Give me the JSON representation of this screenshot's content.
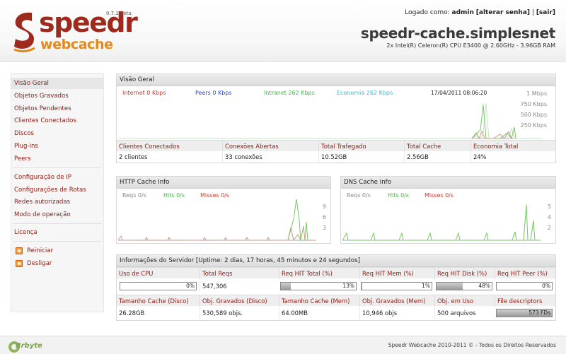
{
  "header": {
    "logo_top": "speedr",
    "logo_bottom": "webcache",
    "version": "0.7.1 beta",
    "login_prefix": "Logado como:",
    "user": "admin",
    "change_password": "[alterar senha]",
    "separator": "|",
    "logout": "[sair]",
    "hostname": "speedr-cache.simplesnet",
    "cpu": "2x Intel(R) Celeron(R) CPU E3400 @ 2.60GHz - 3.96GB RAM"
  },
  "sidebar": {
    "items": [
      {
        "label": "Visão Geral",
        "active": true
      },
      {
        "label": "Objetos Gravados"
      },
      {
        "label": "Objetos Pendentes"
      },
      {
        "label": "Clientes Conectados"
      },
      {
        "label": "Discos"
      },
      {
        "label": "Plug-ins"
      },
      {
        "label": "Peers"
      }
    ],
    "config_items": [
      {
        "label": "Configuração de IP"
      },
      {
        "label": "Configurações de Rotas"
      },
      {
        "label": "Redes autorizadas"
      },
      {
        "label": "Modo de operação"
      }
    ],
    "license": "Licença",
    "actions": [
      {
        "label": "Reiniciar",
        "icon": "restart-icon"
      },
      {
        "label": "Desligar",
        "icon": "power-icon"
      }
    ]
  },
  "overview": {
    "title": "Visão Geral",
    "internet": "Internet 0 Kbps",
    "peers": "Peers 0 Kbps",
    "intranet": "Intranet 262 Kbps",
    "economia": "Economia 262 Kbps",
    "timestamp": "17/04/2011 08:06:20",
    "axis": [
      "1 Mbps",
      "750 Kbps",
      "500 Kbps",
      "250 Kbps"
    ],
    "headers": [
      "Clientes Conectados",
      "Conexões Abertas",
      "Total Trafegado",
      "Total Cache",
      "Economia Total"
    ],
    "values": [
      "2 clientes",
      "33 conexões",
      "10.52GB",
      "2.56GB",
      "24%"
    ]
  },
  "http_cache": {
    "title": "HTTP Cache Info",
    "reqs": "Reqs 0/s",
    "hits": "Hits 0/s",
    "misses": "Misses 0/s",
    "axis": [
      "9",
      "6",
      "3"
    ]
  },
  "dns_cache": {
    "title": "DNS Cache Info",
    "reqs": "Reqs 0/s",
    "hits": "Hits 0/s",
    "misses": "Misses 0/s",
    "axis": [
      "5",
      "4",
      "2"
    ]
  },
  "server": {
    "title": "Informações do Servidor [Uptime: 2 dias, 17 horas, 45 minutos e 24 segundos]",
    "row1_headers": [
      "Uso de CPU",
      "Total Reqs",
      "Req HIT Total (%)",
      "Req HIT Mem (%)",
      "Req HIT Disk (%)",
      "Req HIT Peer (%)"
    ],
    "cpu_usage": {
      "text": "0%",
      "percent": 0
    },
    "total_reqs": "547,306",
    "hit_total": {
      "text": "13%",
      "percent": 13
    },
    "hit_mem": {
      "text": "1%",
      "percent": 1
    },
    "hit_disk": {
      "text": "48%",
      "percent": 48
    },
    "hit_peer": {
      "text": "0%",
      "percent": 0
    },
    "row2_headers": [
      "Tamanho Cache (Disco)",
      "Obj. Gravados (Disco)",
      "Tamanho Cache (Mem)",
      "Obj. Gravados (Mem)",
      "Obj. em Uso",
      "File descriptors"
    ],
    "row2_values": [
      "26.28GB",
      "530,589 objs.",
      "64.00MB",
      "10,946 objs",
      "500 arquivos"
    ],
    "file_descriptors": {
      "text": "573 FDs",
      "percent": 100
    }
  },
  "footer": {
    "brand": "Brbyte",
    "copyright": "Speedr Webcache 2010-2011 © - Todos os Direitos Reservados"
  }
}
